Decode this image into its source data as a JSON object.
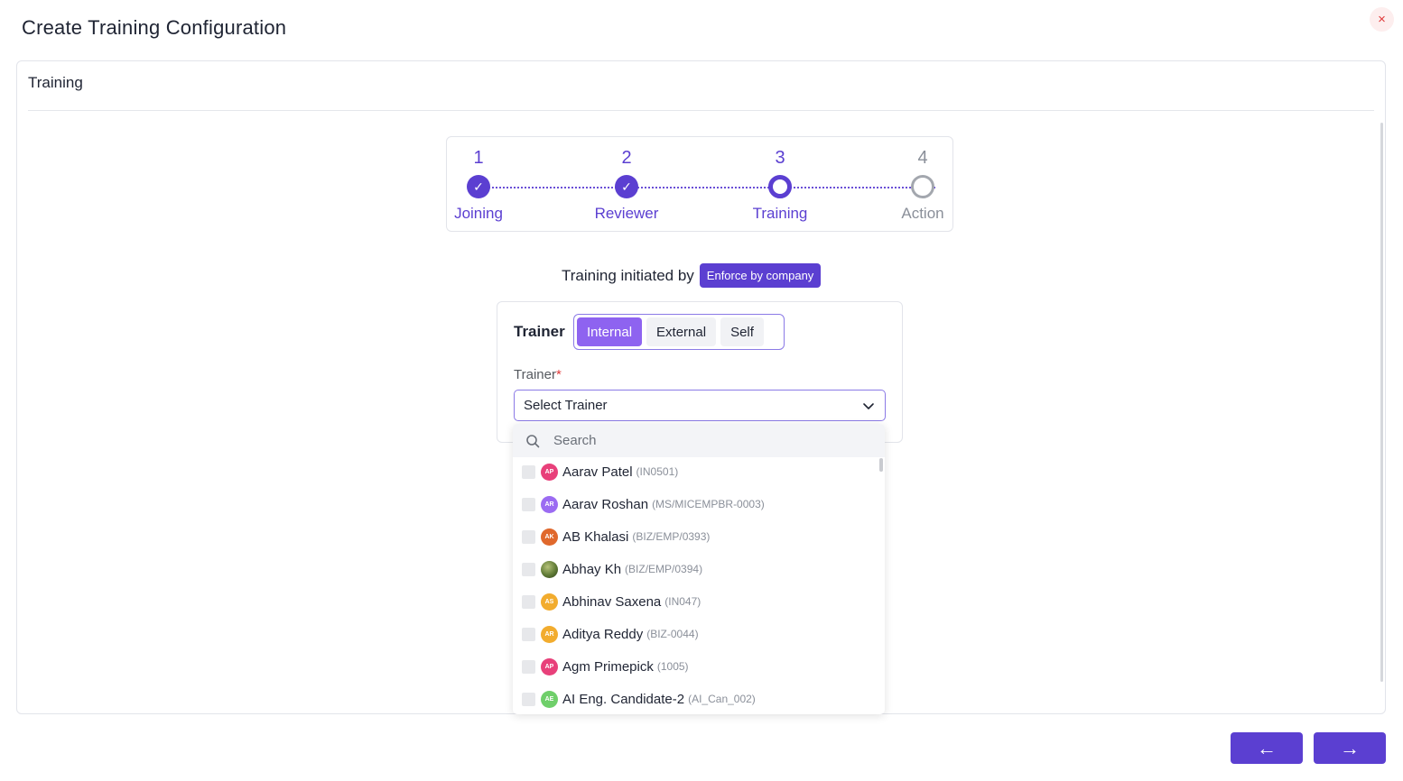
{
  "modal": {
    "title": "Create Training Configuration",
    "close_icon": "×"
  },
  "card": {
    "header": "Training"
  },
  "stepper": {
    "steps": [
      {
        "number": "1",
        "label": "Joining",
        "status": "done"
      },
      {
        "number": "2",
        "label": "Reviewer",
        "status": "done"
      },
      {
        "number": "3",
        "label": "Training",
        "status": "current"
      },
      {
        "number": "4",
        "label": "Action",
        "status": "pending"
      }
    ],
    "check_glyph": "✓"
  },
  "initiated": {
    "text": "Training initiated by",
    "badge": "Enforce by company"
  },
  "trainer": {
    "title": "Trainer",
    "options": [
      "Internal",
      "External",
      "Self"
    ],
    "selected_option": "Internal",
    "field_label": "Trainer",
    "required_mark": "*",
    "select_placeholder": "Select Trainer"
  },
  "dropdown": {
    "search_placeholder": "Search",
    "items": [
      {
        "initials": "AP",
        "name": "Aarav Patel",
        "code": "(IN0501)",
        "color": "#e8407a"
      },
      {
        "initials": "AR",
        "name": "Aarav Roshan",
        "code": "(MS/MICEMPBR-0003)",
        "color": "#9b6bf2"
      },
      {
        "initials": "AK",
        "name": "AB Khalasi",
        "code": "(BIZ/EMP/0393)",
        "color": "#e0682c"
      },
      {
        "initials": "",
        "name": "Abhay Kh",
        "code": "(BIZ/EMP/0394)",
        "color": "#5f7a35"
      },
      {
        "initials": "AS",
        "name": "Abhinav Saxena",
        "code": "(IN047)",
        "color": "#f2ac2e"
      },
      {
        "initials": "AR",
        "name": "Aditya Reddy",
        "code": "(BIZ-0044)",
        "color": "#f2ac2e"
      },
      {
        "initials": "AP",
        "name": "Agm Primepick",
        "code": "(1005)",
        "color": "#e8407a"
      },
      {
        "initials": "AE",
        "name": "AI Eng. Candidate-2",
        "code": "(AI_Can_002)",
        "color": "#6fcf6a"
      }
    ]
  },
  "nav": {
    "back_label": "←",
    "next_label": "→"
  }
}
